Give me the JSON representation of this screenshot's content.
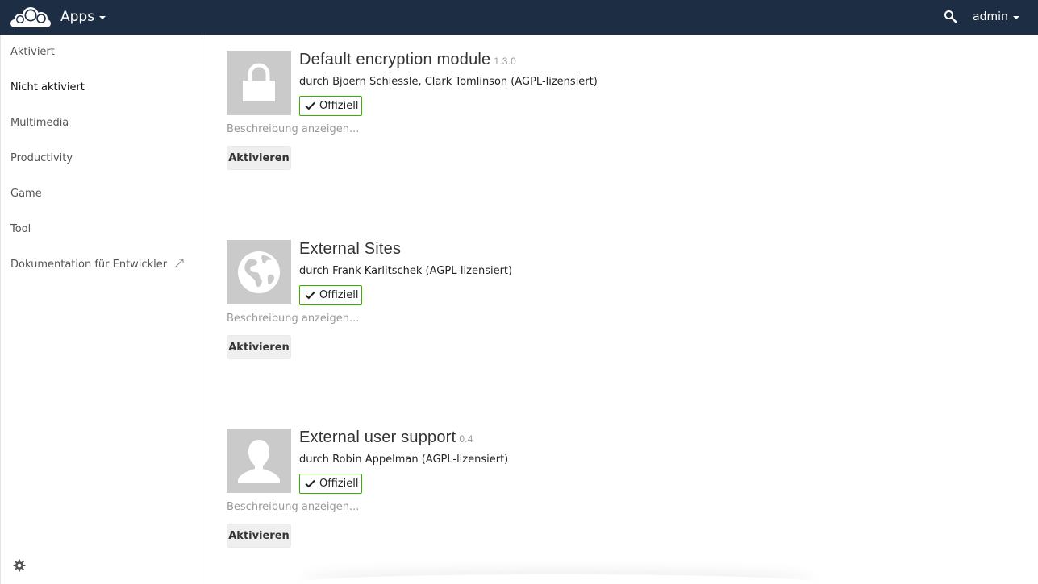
{
  "header": {
    "app_menu_label": "Apps",
    "user_label": "admin",
    "colors": {
      "background": "#1d2d44",
      "text": "#ffffff"
    }
  },
  "sidebar": {
    "items": [
      {
        "label": "Aktiviert"
      },
      {
        "label": "Nicht aktiviert",
        "active": true
      },
      {
        "label": "Multimedia"
      },
      {
        "label": "Productivity"
      },
      {
        "label": "Game"
      },
      {
        "label": "Tool"
      },
      {
        "label": "Dokumentation für Entwickler"
      }
    ]
  },
  "apps": [
    {
      "title": "Default encryption module",
      "version": "1.3.0",
      "author": "durch Bjoern Schiessle, Clark Tomlinson (AGPL-lizensiert)",
      "badge": "Offiziell",
      "description_link": "Beschreibung anzeigen...",
      "button": "Aktivieren",
      "icon": "lock-icon"
    },
    {
      "title": "External Sites",
      "version": "",
      "author": "durch Frank Karlitschek (AGPL-lizensiert)",
      "badge": "Offiziell",
      "description_link": "Beschreibung anzeigen...",
      "button": "Aktivieren",
      "icon": "globe-icon"
    },
    {
      "title": "External user support",
      "version": "0.4",
      "author": "durch Robin Appelman (AGPL-lizensiert)",
      "badge": "Offiziell",
      "description_link": "Beschreibung anzeigen...",
      "button": "Aktivieren",
      "icon": "user-icon"
    }
  ],
  "colors": {
    "official_badge_border": "#37b100",
    "icon_background": "#cacaca",
    "muted_text": "#999999"
  }
}
